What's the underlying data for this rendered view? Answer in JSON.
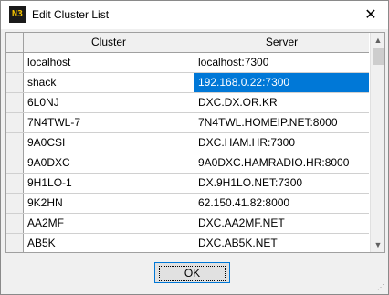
{
  "window": {
    "title": "Edit Cluster List",
    "icon_text": "N3"
  },
  "grid": {
    "columns": [
      "Cluster",
      "Server"
    ],
    "rows": [
      {
        "cluster": "localhost",
        "server": "localhost:7300",
        "selected": false
      },
      {
        "cluster": "shack",
        "server": "192.168.0.22:7300",
        "selected": true
      },
      {
        "cluster": "6L0NJ",
        "server": "DXC.DX.OR.KR",
        "selected": false
      },
      {
        "cluster": "7N4TWL-7",
        "server": "7N4TWL.HOMEIP.NET:8000",
        "selected": false
      },
      {
        "cluster": "9A0CSI",
        "server": "DXC.HAM.HR:7300",
        "selected": false
      },
      {
        "cluster": "9A0DXC",
        "server": "9A0DXC.HAMRADIO.HR:8000",
        "selected": false
      },
      {
        "cluster": "9H1LO-1",
        "server": "DX.9H1LO.NET:7300",
        "selected": false
      },
      {
        "cluster": "9K2HN",
        "server": "62.150.41.82:8000",
        "selected": false
      },
      {
        "cluster": "AA2MF",
        "server": "DXC.AA2MF.NET",
        "selected": false
      },
      {
        "cluster": "AB5K",
        "server": "DXC.AB5K.NET",
        "selected": false
      }
    ]
  },
  "buttons": {
    "ok": "OK"
  },
  "colors": {
    "selection": "#0078d7",
    "accent_border": "#0078d7"
  }
}
